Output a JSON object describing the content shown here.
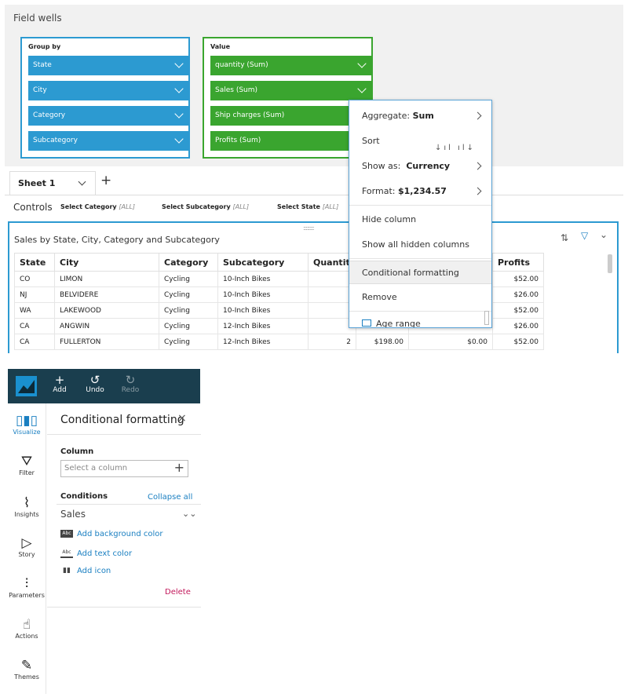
{
  "field_wells": {
    "title": "Field wells",
    "group_by": {
      "title": "Group by",
      "items": [
        "State",
        "City",
        "Category",
        "Subcategory"
      ]
    },
    "value": {
      "title": "Value",
      "items": [
        "quantity (Sum)",
        "Sales (Sum)",
        "Ship charges (Sum)",
        "Profits (Sum)"
      ]
    }
  },
  "tabs": {
    "sheet": "Sheet 1",
    "add": "+"
  },
  "controls": {
    "label": "Controls",
    "items": [
      {
        "label": "Select Category",
        "value": "[ALL]"
      },
      {
        "label": "Select Subcategory",
        "value": "[ALL]"
      },
      {
        "label": "Select State",
        "value": "[ALL]"
      }
    ]
  },
  "visual": {
    "title": "Sales by State, City, Category and Subcategory",
    "handle": "::::::::",
    "columns": [
      "State",
      "City",
      "Category",
      "Subcategory",
      "Quantit",
      "",
      "",
      "Profits"
    ],
    "rows": [
      [
        "CO",
        "LIMON",
        "Cycling",
        "10-Inch Bikes",
        "",
        "",
        "",
        "$52.00"
      ],
      [
        "NJ",
        "BELVIDERE",
        "Cycling",
        "10-Inch Bikes",
        "",
        "",
        "",
        "$26.00"
      ],
      [
        "WA",
        "LAKEWOOD",
        "Cycling",
        "10-Inch Bikes",
        "",
        "",
        "",
        "$52.00"
      ],
      [
        "CA",
        "ANGWIN",
        "Cycling",
        "12-Inch Bikes",
        "",
        "",
        "",
        "$26.00"
      ],
      [
        "CA",
        "FULLERTON",
        "Cycling",
        "12-Inch Bikes",
        "2",
        "$198.00",
        "$0.00",
        "$52.00"
      ]
    ]
  },
  "context_menu": {
    "aggregate_label": "Aggregate:",
    "aggregate_value": "Sum",
    "sort": "Sort",
    "sort_icons": "↓ıl ıl↓",
    "show_as_label": "Show as:",
    "show_as_value": "Currency",
    "format_label": "Format:",
    "format_value": "$1,234.57",
    "hide_column": "Hide column",
    "show_hidden": "Show all hidden columns",
    "conditional_formatting": "Conditional formatting",
    "remove": "Remove",
    "age_range": "Age range"
  },
  "toolbar": {
    "add": {
      "icon": "+",
      "label": "Add"
    },
    "undo": {
      "icon": "↺",
      "label": "Undo"
    },
    "redo": {
      "icon": "↻",
      "label": "Redo"
    }
  },
  "left_nav": [
    {
      "icon": "▯▮▯",
      "label": "Visualize"
    },
    {
      "icon": "⛛",
      "label": "Filter"
    },
    {
      "icon": "⌇",
      "label": "Insights"
    },
    {
      "icon": "▷",
      "label": "Story"
    },
    {
      "icon": "⫶",
      "label": "Parameters"
    },
    {
      "icon": "☝",
      "label": "Actions"
    },
    {
      "icon": "✎",
      "label": "Themes"
    }
  ],
  "cf_panel": {
    "title": "Conditional formatting",
    "close": "×",
    "column_label": "Column",
    "column_placeholder": "Select a column",
    "conditions_label": "Conditions",
    "collapse_all": "Collapse all",
    "condition_name": "Sales",
    "options": [
      "Add background color",
      "Add text color",
      "Add icon"
    ],
    "option_icons": [
      "Abc",
      "Abc",
      "▮▮"
    ],
    "delete": "Delete"
  },
  "colors": {
    "group_blue": "#2c9ad1",
    "value_green": "#3aa52f",
    "toolbar": "#1a3e4e",
    "link": "#1a7fc1",
    "delete": "#c2185b"
  }
}
